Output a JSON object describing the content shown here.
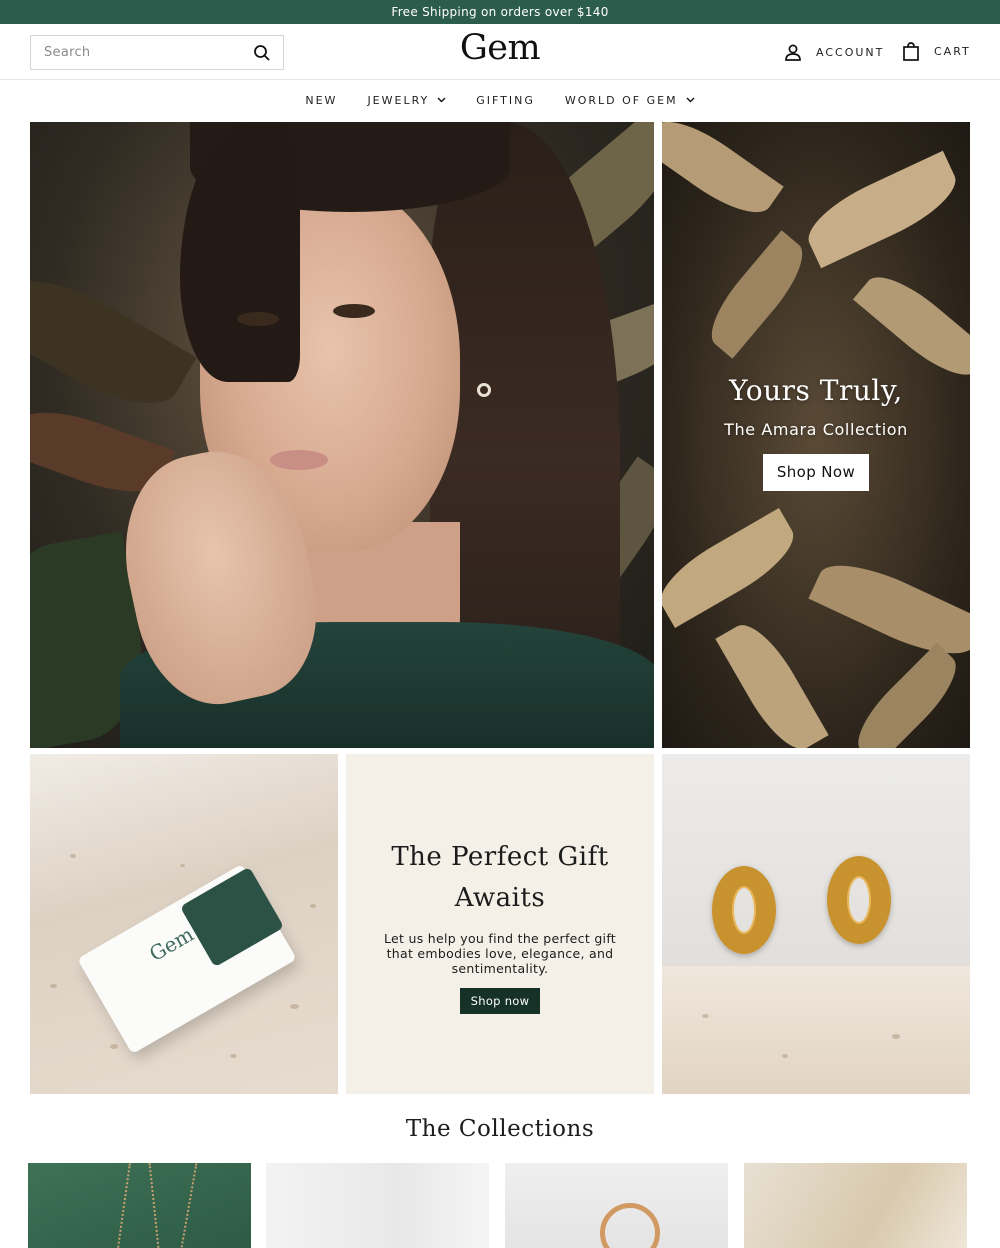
{
  "announcement": {
    "text": "Free Shipping on orders over $140"
  },
  "header": {
    "search_placeholder": "Search",
    "logo": "Gem",
    "account_label": "ACCOUNT",
    "cart_label": "CART"
  },
  "nav": {
    "items": [
      {
        "label": "NEW",
        "has_dropdown": false
      },
      {
        "label": "JEWELRY",
        "has_dropdown": true
      },
      {
        "label": "GIFTING",
        "has_dropdown": false
      },
      {
        "label": "WORLD OF GEM",
        "has_dropdown": true
      }
    ]
  },
  "hero": {
    "title": "Yours Truly,",
    "subtitle": "The Amara Collection",
    "button_label": "Shop Now"
  },
  "gift_card": {
    "logo_text": "Gem"
  },
  "promo": {
    "title": "The Perfect Gift Awaits",
    "body": "Let us help you find the perfect gift that embodies love, elegance, and sentimentality.",
    "button_label": "Shop now"
  },
  "collections": {
    "title": "The Collections"
  },
  "colors": {
    "announcement_bg": "#2c5c4c",
    "promo_bg": "#f4f0e8",
    "promo_button": "#163228"
  }
}
